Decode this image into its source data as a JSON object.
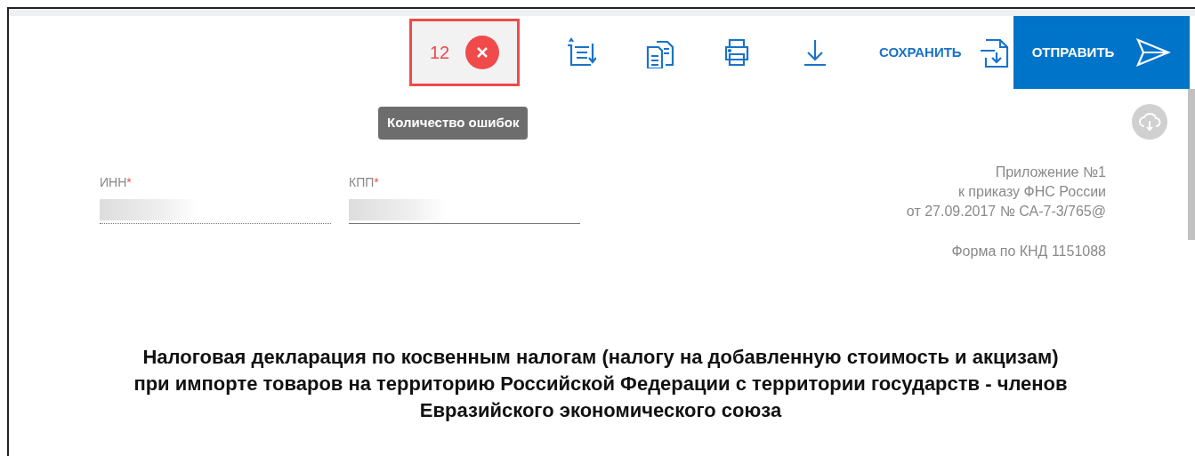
{
  "toolbar": {
    "error_count": {
      "count": "12",
      "highlighted": true
    },
    "save_label": "СОХРАНИТЬ",
    "send_label": "ОТПРАВИТЬ"
  },
  "tooltip": "Количество ошибок",
  "fields": [
    {
      "label": "ИНН",
      "required_mark": "*",
      "readonly": true
    },
    {
      "label": "КПП",
      "required_mark": "*",
      "readonly": false
    }
  ],
  "appendix": [
    "Приложение №1",
    "к приказу ФНС России",
    "от 27.09.2017 № СА-7-3/765@"
  ],
  "form_code": "Форма по КНД 1151088",
  "title": "Налоговая декларация по косвенным налогам (налогу на добавленную стоимость и акцизам) при импорте товаров на территорию Российской Федерации с территории государств - членов Евразийского экономического союза"
}
